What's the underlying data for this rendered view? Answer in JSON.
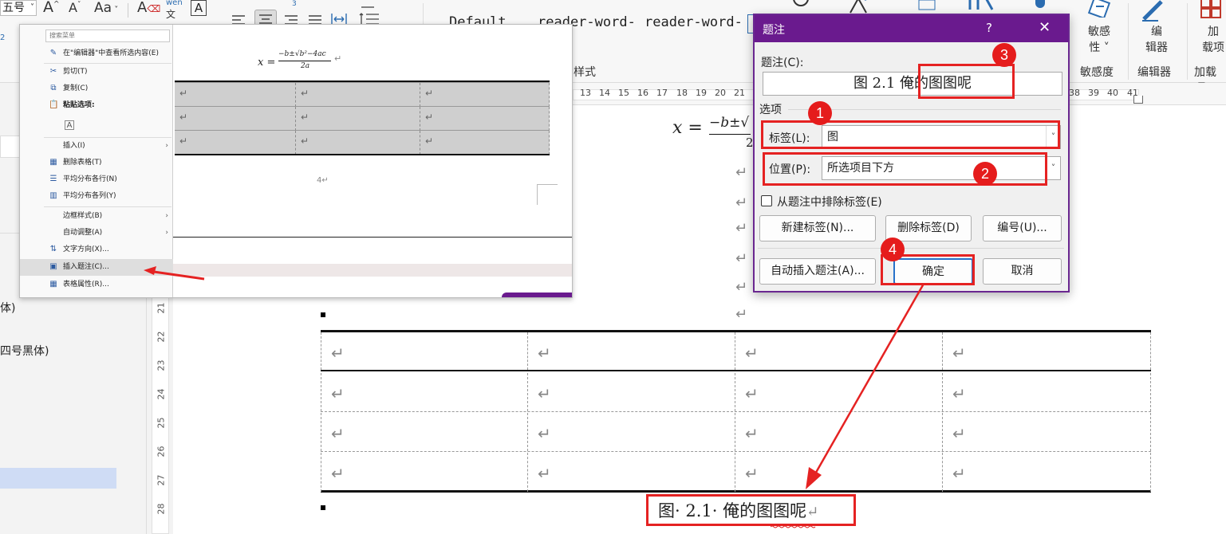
{
  "ribbon": {
    "font_size_value": "五号",
    "glyph_grow": "A",
    "glyph_shrink": "A",
    "glyph_case": "Aa",
    "glyph_clear": "A",
    "phonetic_top": "wén",
    "phonetic_bottom": "文",
    "glyph_border_char": "A",
    "style_items": [
      "Default",
      "reader-word-",
      "reader-word-"
    ],
    "styles_group_label": "样式",
    "sensitivity_button": "敏感\n性 ˅",
    "sensitivity_group": "敏感度",
    "editor_button": "编\n辑器",
    "editor_group": "编辑器",
    "addins_button": "加\n载项",
    "addins_group": "加载项",
    "small_number": "2"
  },
  "ruler": {
    "numbers": [
      "13",
      "14",
      "15",
      "16",
      "17",
      "18",
      "19",
      "20",
      "21",
      "38",
      "39",
      "40",
      "41"
    ]
  },
  "nav": {
    "item_1": "体)",
    "item_2": "四号黑体)"
  },
  "vertical_ruler": {
    "numbers": [
      "21",
      "22",
      "23",
      "24",
      "25",
      "26",
      "27",
      "28"
    ]
  },
  "inset": {
    "equation_x": "x =",
    "equation_top": "−b±√b²−4ac",
    "equation_bottom": "2a",
    "page_number": "4↵",
    "return_mark": "↵",
    "menu": {
      "search_placeholder": "搜索菜单",
      "items": [
        {
          "label": "在\"编辑器\"中查看所选内容(E)",
          "icon": "✎"
        },
        {
          "label": "剪切(T)",
          "icon": "✂"
        },
        {
          "label": "复制(C)",
          "icon": "⧉"
        },
        {
          "label": "粘贴选项:",
          "icon": "📋"
        },
        {
          "label": "",
          "icon": "A"
        },
        {
          "label": "插入(I)",
          "icon": "",
          "arrow": "›"
        },
        {
          "label": "删除表格(T)",
          "icon": "▦"
        },
        {
          "label": "平均分布各行(N)",
          "icon": "☰"
        },
        {
          "label": "平均分布各列(Y)",
          "icon": "▥"
        },
        {
          "label": "边框样式(B)",
          "icon": "",
          "arrow": "›"
        },
        {
          "label": "自动调整(A)",
          "icon": "",
          "arrow": "›"
        },
        {
          "label": "文字方向(X)...",
          "icon": "⇅"
        },
        {
          "label": "插入题注(C)...",
          "icon": "▣"
        },
        {
          "label": "表格属性(R)...",
          "icon": "▦"
        }
      ]
    }
  },
  "document": {
    "equation_x": "x =",
    "equation_top": "−b±√",
    "equation_bottom": "2",
    "return_mark": "↵",
    "final_caption": "图· 2.1· 俺的图图呢",
    "final_caption_return": "↵"
  },
  "dialog": {
    "title": "题注",
    "help": "?",
    "close": "✕",
    "caption_label": "题注(C):",
    "caption_value": "图 2.1 俺的图图呢",
    "options_label": "选项",
    "label_label": "标签(L):",
    "label_value": "图",
    "position_label": "位置(P):",
    "position_value": "所选项目下方",
    "exclude_label": "从题注中排除标签(E)",
    "btn_new_label": "新建标签(N)...",
    "btn_delete_label": "删除标签(D)",
    "btn_numbering": "编号(U)...",
    "btn_autoinsert": "自动插入题注(A)...",
    "btn_ok": "确定",
    "btn_cancel": "取消",
    "chevron": "˅"
  },
  "badges": [
    "1",
    "2",
    "3",
    "4"
  ],
  "colors": {
    "dialog_titlebar": "#6a1a8e",
    "annotation_red": "#e52222",
    "primary_button_border": "#2872c9",
    "nav_highlight": "#cfdcf5"
  }
}
